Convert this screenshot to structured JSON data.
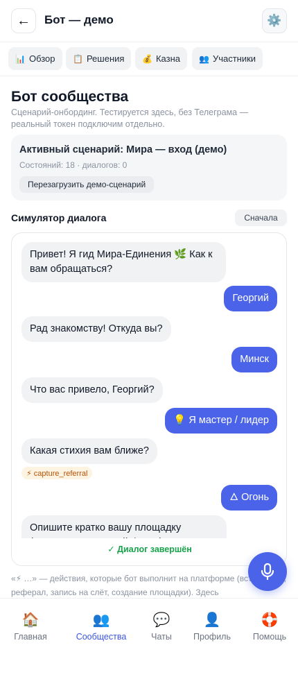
{
  "header": {
    "title": "Бот — демо",
    "back_icon": "←",
    "settings_icon": "⚙️"
  },
  "tabs": [
    {
      "icon": "📊",
      "label": "Обзор"
    },
    {
      "icon": "📋",
      "label": "Решения"
    },
    {
      "icon": "💰",
      "label": "Казна"
    },
    {
      "icon": "👥",
      "label": "Участники"
    }
  ],
  "section": {
    "title": "Бот сообщества",
    "description": "Сценарий-онбординг. Тестируется здесь, без Телеграма — реальный токен подключим отдельно."
  },
  "scenario": {
    "title": "Активный сценарий: Мира — вход (демо)",
    "meta": "Состояний: 18 · диалогов: 0",
    "reload_label": "Перезагрузить демо-сценарий"
  },
  "simulator": {
    "title": "Симулятор диалога",
    "restart_label": "Сначала",
    "messages": [
      {
        "from": "bot",
        "text": "Привет! Я гид Мира-Единения 🌿 Как к вам обращаться?"
      },
      {
        "from": "user",
        "text": "Георгий"
      },
      {
        "from": "bot",
        "text": "Рад знакомству! Откуда вы?"
      },
      {
        "from": "user",
        "text": "Минск"
      },
      {
        "from": "bot",
        "text": "Что вас привело, Георгий?"
      },
      {
        "from": "user",
        "text": "💡 Я мастер / лидер"
      },
      {
        "from": "bot",
        "text": "Какая стихия вам ближе?"
      },
      {
        "from": "action",
        "text": "⚡ capture_referral"
      },
      {
        "from": "user",
        "text": "🜂 Огонь"
      },
      {
        "from": "bot",
        "text": "Опишите кратко вашу площадку (название, где, какой фокус)"
      }
    ],
    "status": "✓ Диалог завершён"
  },
  "mic_icon": "microphone",
  "footnote": "«⚡ …» — действия, которые бот выполнит на платформе (вступление, реферал, запись на слёт, создание площадки). Здесь",
  "bottom_nav": [
    {
      "icon": "🏠",
      "label": "Главная",
      "active": false
    },
    {
      "icon": "👥",
      "label": "Сообщества",
      "active": true
    },
    {
      "icon": "💬",
      "label": "Чаты",
      "active": false
    },
    {
      "icon": "👤",
      "label": "Профиль",
      "active": false
    },
    {
      "icon": "🛟",
      "label": "Помощь",
      "active": false
    }
  ],
  "colors": {
    "accent": "#4a63e8",
    "success": "#16a34a",
    "action_bg": "#fdf3e1",
    "action_text": "#b45309"
  }
}
